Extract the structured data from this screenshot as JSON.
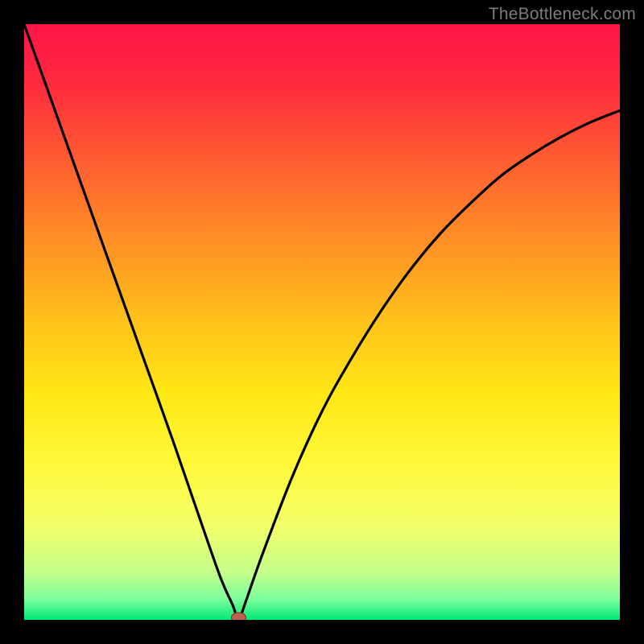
{
  "watermark": {
    "text": "TheBottleneck.com"
  },
  "chart_data": {
    "type": "line",
    "title": "",
    "xlabel": "",
    "ylabel": "",
    "xlim": [
      0,
      100
    ],
    "ylim": [
      0,
      100
    ],
    "marker": {
      "x": 36,
      "y": 0
    },
    "series": [
      {
        "name": "curve",
        "x": [
          0,
          5,
          10,
          15,
          20,
          25,
          30,
          33,
          35,
          36,
          37,
          40,
          45,
          50,
          55,
          60,
          65,
          70,
          75,
          80,
          85,
          90,
          95,
          100
        ],
        "y": [
          100,
          86,
          72,
          58,
          44,
          30,
          15.5,
          7,
          2.5,
          0,
          2.5,
          11,
          24,
          35,
          44,
          52,
          59,
          65,
          70,
          74.5,
          78,
          81,
          83.5,
          85.5
        ]
      }
    ],
    "gradient_stops": [
      {
        "pos": 0.0,
        "color": "#ff1446"
      },
      {
        "pos": 0.1,
        "color": "#ff2a3e"
      },
      {
        "pos": 0.22,
        "color": "#ff5a32"
      },
      {
        "pos": 0.35,
        "color": "#ff8a26"
      },
      {
        "pos": 0.5,
        "color": "#ffc31a"
      },
      {
        "pos": 0.62,
        "color": "#ffe714"
      },
      {
        "pos": 0.74,
        "color": "#fff93a"
      },
      {
        "pos": 0.84,
        "color": "#f3ff67"
      },
      {
        "pos": 0.92,
        "color": "#c4ff8a"
      },
      {
        "pos": 0.965,
        "color": "#7dff9c"
      },
      {
        "pos": 1.0,
        "color": "#00e876"
      }
    ]
  }
}
